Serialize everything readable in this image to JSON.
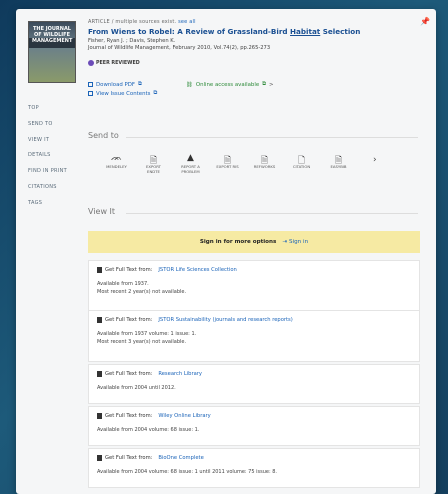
{
  "article": {
    "type_label": "ARTICLE",
    "sources_text": "/ multiple sources exist.",
    "see_all": "see all",
    "title_pre": "From Wiens to Robel: A Review of Grassland-Bird ",
    "title_hl": "Habitat",
    "title_post": " Selection",
    "authors": "Fisher, Ryan J. ; Davis, Stephen K.",
    "journal": "Journal of Wildlife Management, February 2010, Vol.74(2), pp.265-273",
    "peer_reviewed": "PEER REVIEWED",
    "cover_text": "THE JOURNAL OF WILDLIFE MANAGEMENT"
  },
  "links": {
    "download_pdf": "Download PDF",
    "view_issue": "View Issue Contents",
    "online_access": "Online access available",
    "more": ">"
  },
  "nav": [
    "TOP",
    "SEND TO",
    "VIEW IT",
    "DETAILS",
    "FIND IN PRINT",
    "CITATIONS",
    "TAGS"
  ],
  "send_to": {
    "title": "Send to",
    "tools": [
      {
        "icon": "mendeley-icon",
        "glyph": "ᨏ",
        "label": "MENDELEY"
      },
      {
        "icon": "export-ris-icon",
        "glyph": "🗎",
        "label": "EXPORT\nENDTE"
      },
      {
        "icon": "report-problem-icon",
        "glyph": "▲",
        "label": "REPORT A\nPROBLEM"
      },
      {
        "icon": "export-ris-icon",
        "glyph": "🗎",
        "label": "EXPORT RIS"
      },
      {
        "icon": "refworks-icon",
        "glyph": "🗎",
        "label": "REFWORKS"
      },
      {
        "icon": "citation-icon",
        "glyph": "🗋",
        "label": "CITATION"
      },
      {
        "icon": "easybib-icon",
        "glyph": "🗎",
        "label": "EASYBIB"
      }
    ],
    "next": "›"
  },
  "view_it": {
    "title": "View It",
    "signin_prompt": "Sign in for more options",
    "signin_link": "Sign in",
    "get_text_label": "Get Full Text from:",
    "sources": [
      {
        "name": "JSTOR Life Sciences Collection",
        "lines": [
          "Available from 1937.",
          "Most recent 2 year(s) not available."
        ]
      },
      {
        "name": "JSTOR Sustainability (journals and research reports)",
        "lines": [
          "Available from 1937 volume: 1 issue: 1.",
          "Most recent 3 year(s) not available."
        ]
      },
      {
        "name": "Research Library",
        "lines": [
          "Available from 2004 until 2012."
        ]
      },
      {
        "name": "Wiley Online Library",
        "lines": [
          "Available from 2004 volume: 68 issue: 1."
        ]
      },
      {
        "name": "BioOne Complete",
        "lines": [
          "Available from 2004 volume: 68 issue: 1 until 2011 volume: 75 issue: 8."
        ]
      }
    ]
  },
  "colors": {
    "link": "#1a63b8",
    "online": "#2e8b3a",
    "signin_bar": "#f6eaa3",
    "background": "#153f5e"
  }
}
